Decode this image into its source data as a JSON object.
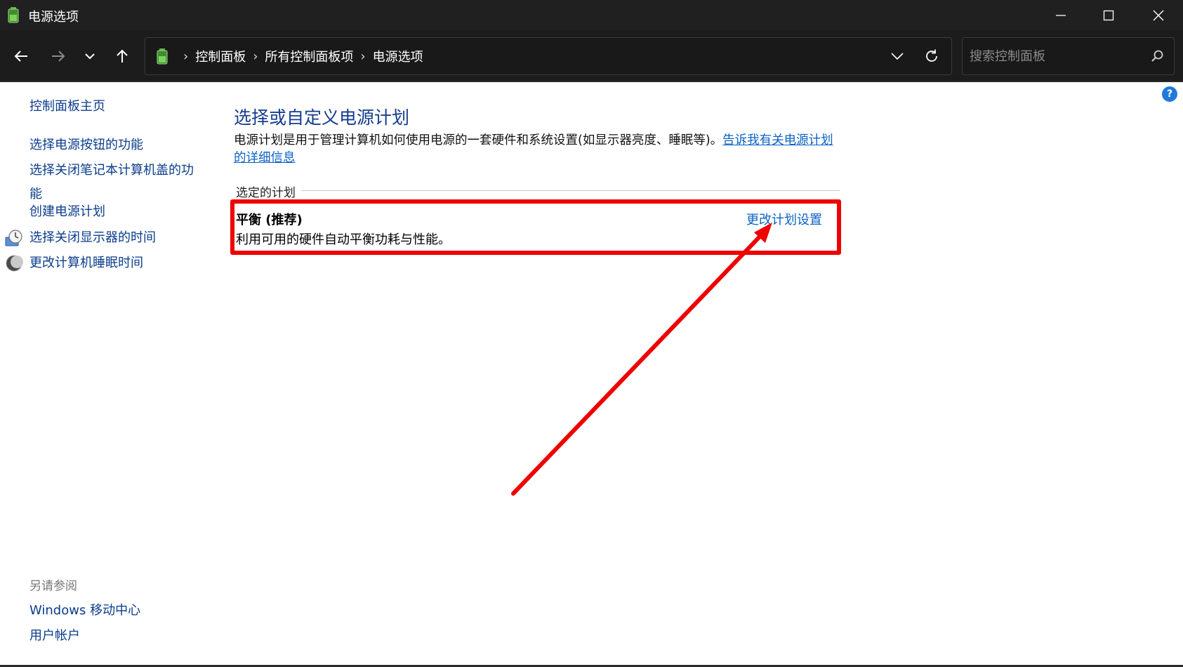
{
  "window": {
    "title": "电源选项"
  },
  "navbar": {
    "breadcrumbs": [
      "控制面板",
      "所有控制面板项",
      "电源选项"
    ],
    "search_placeholder": "搜索控制面板"
  },
  "help": {
    "label": "?"
  },
  "leftnav": {
    "home": "控制面板主页",
    "items": [
      "选择电源按钮的功能",
      "选择关闭笔记本计算机盖的功能",
      "创建电源计划",
      "选择关闭显示器的时间",
      "更改计算机睡眠时间"
    ],
    "see_also_label": "另请参阅",
    "see_also": [
      "Windows 移动中心",
      "用户帐户"
    ]
  },
  "main": {
    "title": "选择或自定义电源计划",
    "description": "电源计划是用于管理计算机如何使用电源的一套硬件和系统设置(如显示器亮度、睡眠等)。",
    "description_link": "告诉我有关电源计划的详细信息",
    "section_label": "选定的计划",
    "plan": {
      "name": "平衡 (推荐)",
      "description": "利用可用的硬件自动平衡功耗与性能。",
      "change_link": "更改计划设置"
    }
  },
  "colors": {
    "titlebar_bg": "#202020",
    "navbar_bg": "#1c1c1c",
    "link": "#0b3d8c",
    "title_blue": "#163c8e",
    "annotation_red": "#ee0000"
  }
}
